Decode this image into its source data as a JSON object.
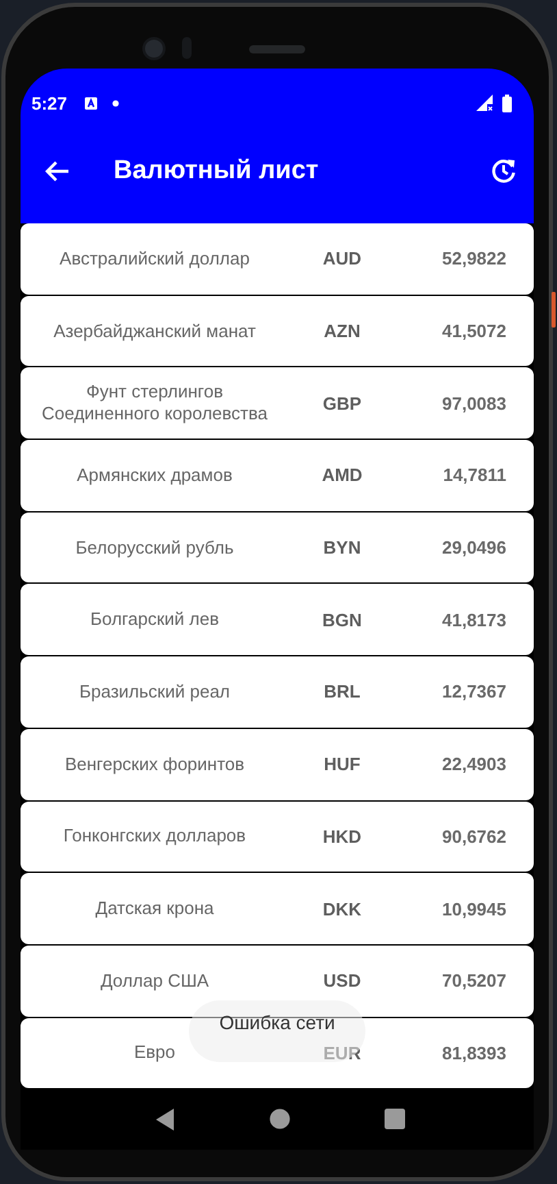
{
  "status_bar": {
    "time": "5:27"
  },
  "toolbar": {
    "title": "Валютный лист"
  },
  "currencies": [
    {
      "name": "Австралийский доллар",
      "code": "AUD",
      "rate": "52,9822"
    },
    {
      "name": "Азербайджанский манат",
      "code": "AZN",
      "rate": "41,5072"
    },
    {
      "name": "Фунт стерлингов Соединенного королевства",
      "code": "GBP",
      "rate": "97,0083"
    },
    {
      "name": "Армянских драмов",
      "code": "AMD",
      "rate": "14,7811"
    },
    {
      "name": "Белорусский рубль",
      "code": "BYN",
      "rate": "29,0496"
    },
    {
      "name": "Болгарский лев",
      "code": "BGN",
      "rate": "41,8173"
    },
    {
      "name": "Бразильский реал",
      "code": "BRL",
      "rate": "12,7367"
    },
    {
      "name": "Венгерских форинтов",
      "code": "HUF",
      "rate": "22,4903"
    },
    {
      "name": "Гонконгских долларов",
      "code": "HKD",
      "rate": "90,6762"
    },
    {
      "name": "Датская крона",
      "code": "DKK",
      "rate": "10,9945"
    },
    {
      "name": "Доллар США",
      "code": "USD",
      "rate": "70,5207"
    },
    {
      "name": "Евро",
      "code": "EUR",
      "rate": "81,8393"
    }
  ],
  "toast": {
    "message": "Ошибка сети"
  }
}
